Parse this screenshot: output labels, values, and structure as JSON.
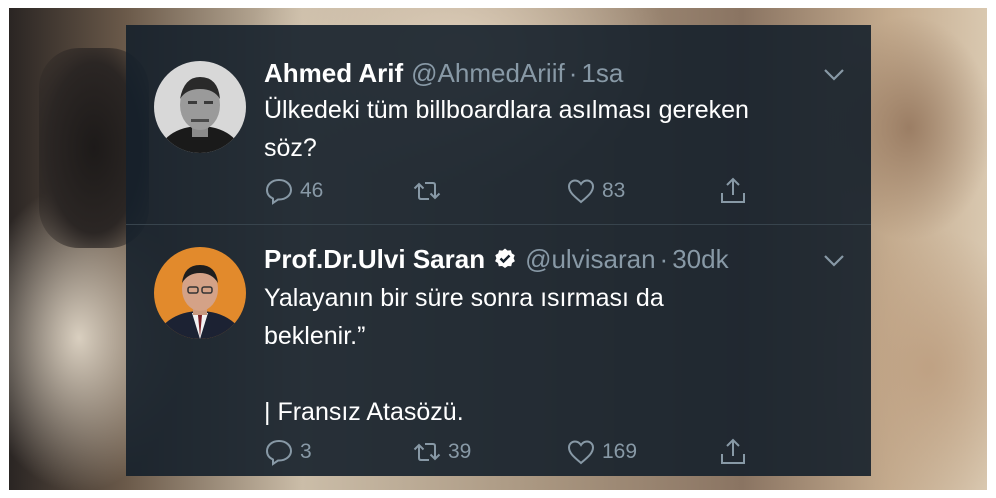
{
  "tweets": [
    {
      "name": "Ahmed Arif",
      "handle": "@AhmedAriif",
      "separator": "·",
      "time": "1sa",
      "verified": false,
      "text_lines": [
        "Ülkedeki tüm billboardlara asılması gereken",
        "söz?"
      ],
      "replies": "46",
      "retweets": "",
      "likes": "83"
    },
    {
      "name": "Prof.Dr.Ulvi Saran",
      "handle": "@ulvisaran",
      "separator": "·",
      "time": "30dk",
      "verified": true,
      "text_lines": [
        "Yalayanın bir süre sonra ısırması da",
        "beklenir.”",
        "",
        "| Fransız Atasözü."
      ],
      "replies": "3",
      "retweets": "39",
      "likes": "169"
    }
  ],
  "colors": {
    "panel_bg": "#15202b",
    "text_primary": "#ffffff",
    "text_secondary": "#8899a6",
    "verified_badge": "#ffffff",
    "divider": "#38444d"
  },
  "icons": {
    "reply": "reply-icon",
    "retweet": "retweet-icon",
    "like": "like-icon",
    "share": "share-icon",
    "chevron": "chevron-down-icon",
    "verified": "verified-badge-icon"
  }
}
